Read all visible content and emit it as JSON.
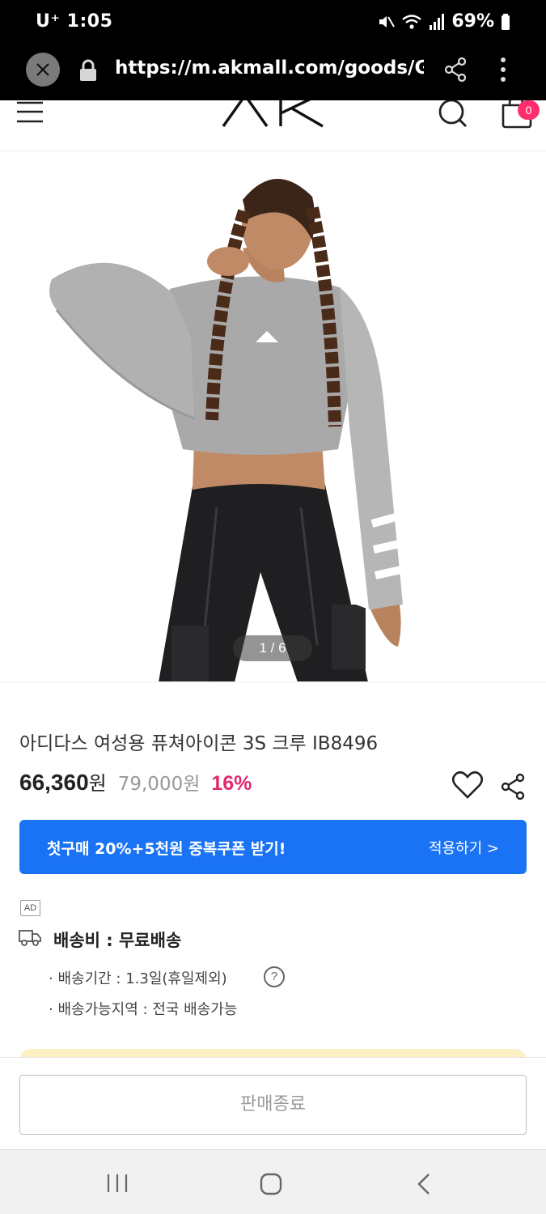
{
  "status_bar": {
    "carrier": "U⁺",
    "time": "1:05",
    "battery": "69%",
    "icons": [
      "mute-icon",
      "wifi-icon",
      "signal-icon",
      "battery-icon"
    ]
  },
  "browser": {
    "url": "https://m.akmall.com/goods/Go",
    "icons": [
      "close-icon",
      "lock-icon",
      "share-icon",
      "more-vertical-icon"
    ]
  },
  "header": {
    "logo_text": "AK",
    "cart_count": "0",
    "icons": [
      "hamburger-icon",
      "search-icon",
      "cart-icon"
    ]
  },
  "gallery": {
    "counter": "1 / 6"
  },
  "product": {
    "name": "아디다스 여성용 퓨쳐아이콘 3S 크루 IB8496",
    "sale_price": "66,360",
    "currency": "원",
    "original_price": "79,000원",
    "discount": "16%"
  },
  "coupon": {
    "text": "첫구매 20%+5천원 중복쿠폰 받기!",
    "apply_label": "적용하기 >"
  },
  "delivery": {
    "ad_label": "AD",
    "title": "배송비 : 무료배송",
    "period": "· 배송기간 : 1.3일(휴일제외)",
    "region": "· 배송가능지역 : 전국 배송가능",
    "help_label": "?"
  },
  "cta": {
    "soldout_label": "판매종료"
  },
  "colors": {
    "accent_blue": "#1a73f5",
    "discount_pink": "#e0286e",
    "badge_pink": "#ff2d6e"
  }
}
